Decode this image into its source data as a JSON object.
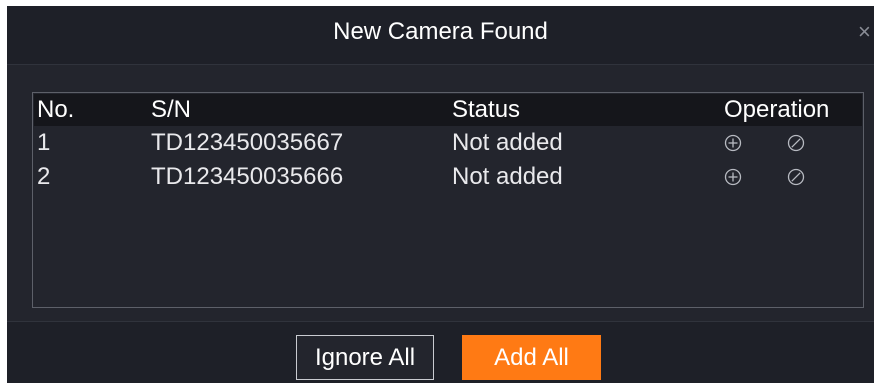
{
  "dialog": {
    "title": "New Camera Found",
    "close_icon": "close-icon",
    "colors": {
      "background": "#1e2028",
      "body": "#23252d",
      "table_header": "#15161b",
      "accent": "#ff7a14"
    }
  },
  "table": {
    "headers": {
      "no": "No.",
      "sn": "S/N",
      "status": "Status",
      "operation": "Operation"
    },
    "rows": [
      {
        "no": "1",
        "sn": "TD123450035667",
        "status": "Not added",
        "add_icon": "add-circle-icon",
        "ignore_icon": "ignore-circle-icon"
      },
      {
        "no": "2",
        "sn": "TD123450035666",
        "status": "Not added",
        "add_icon": "add-circle-icon",
        "ignore_icon": "ignore-circle-icon"
      }
    ]
  },
  "footer": {
    "ignore_all_label": "Ignore All",
    "add_all_label": "Add All"
  }
}
